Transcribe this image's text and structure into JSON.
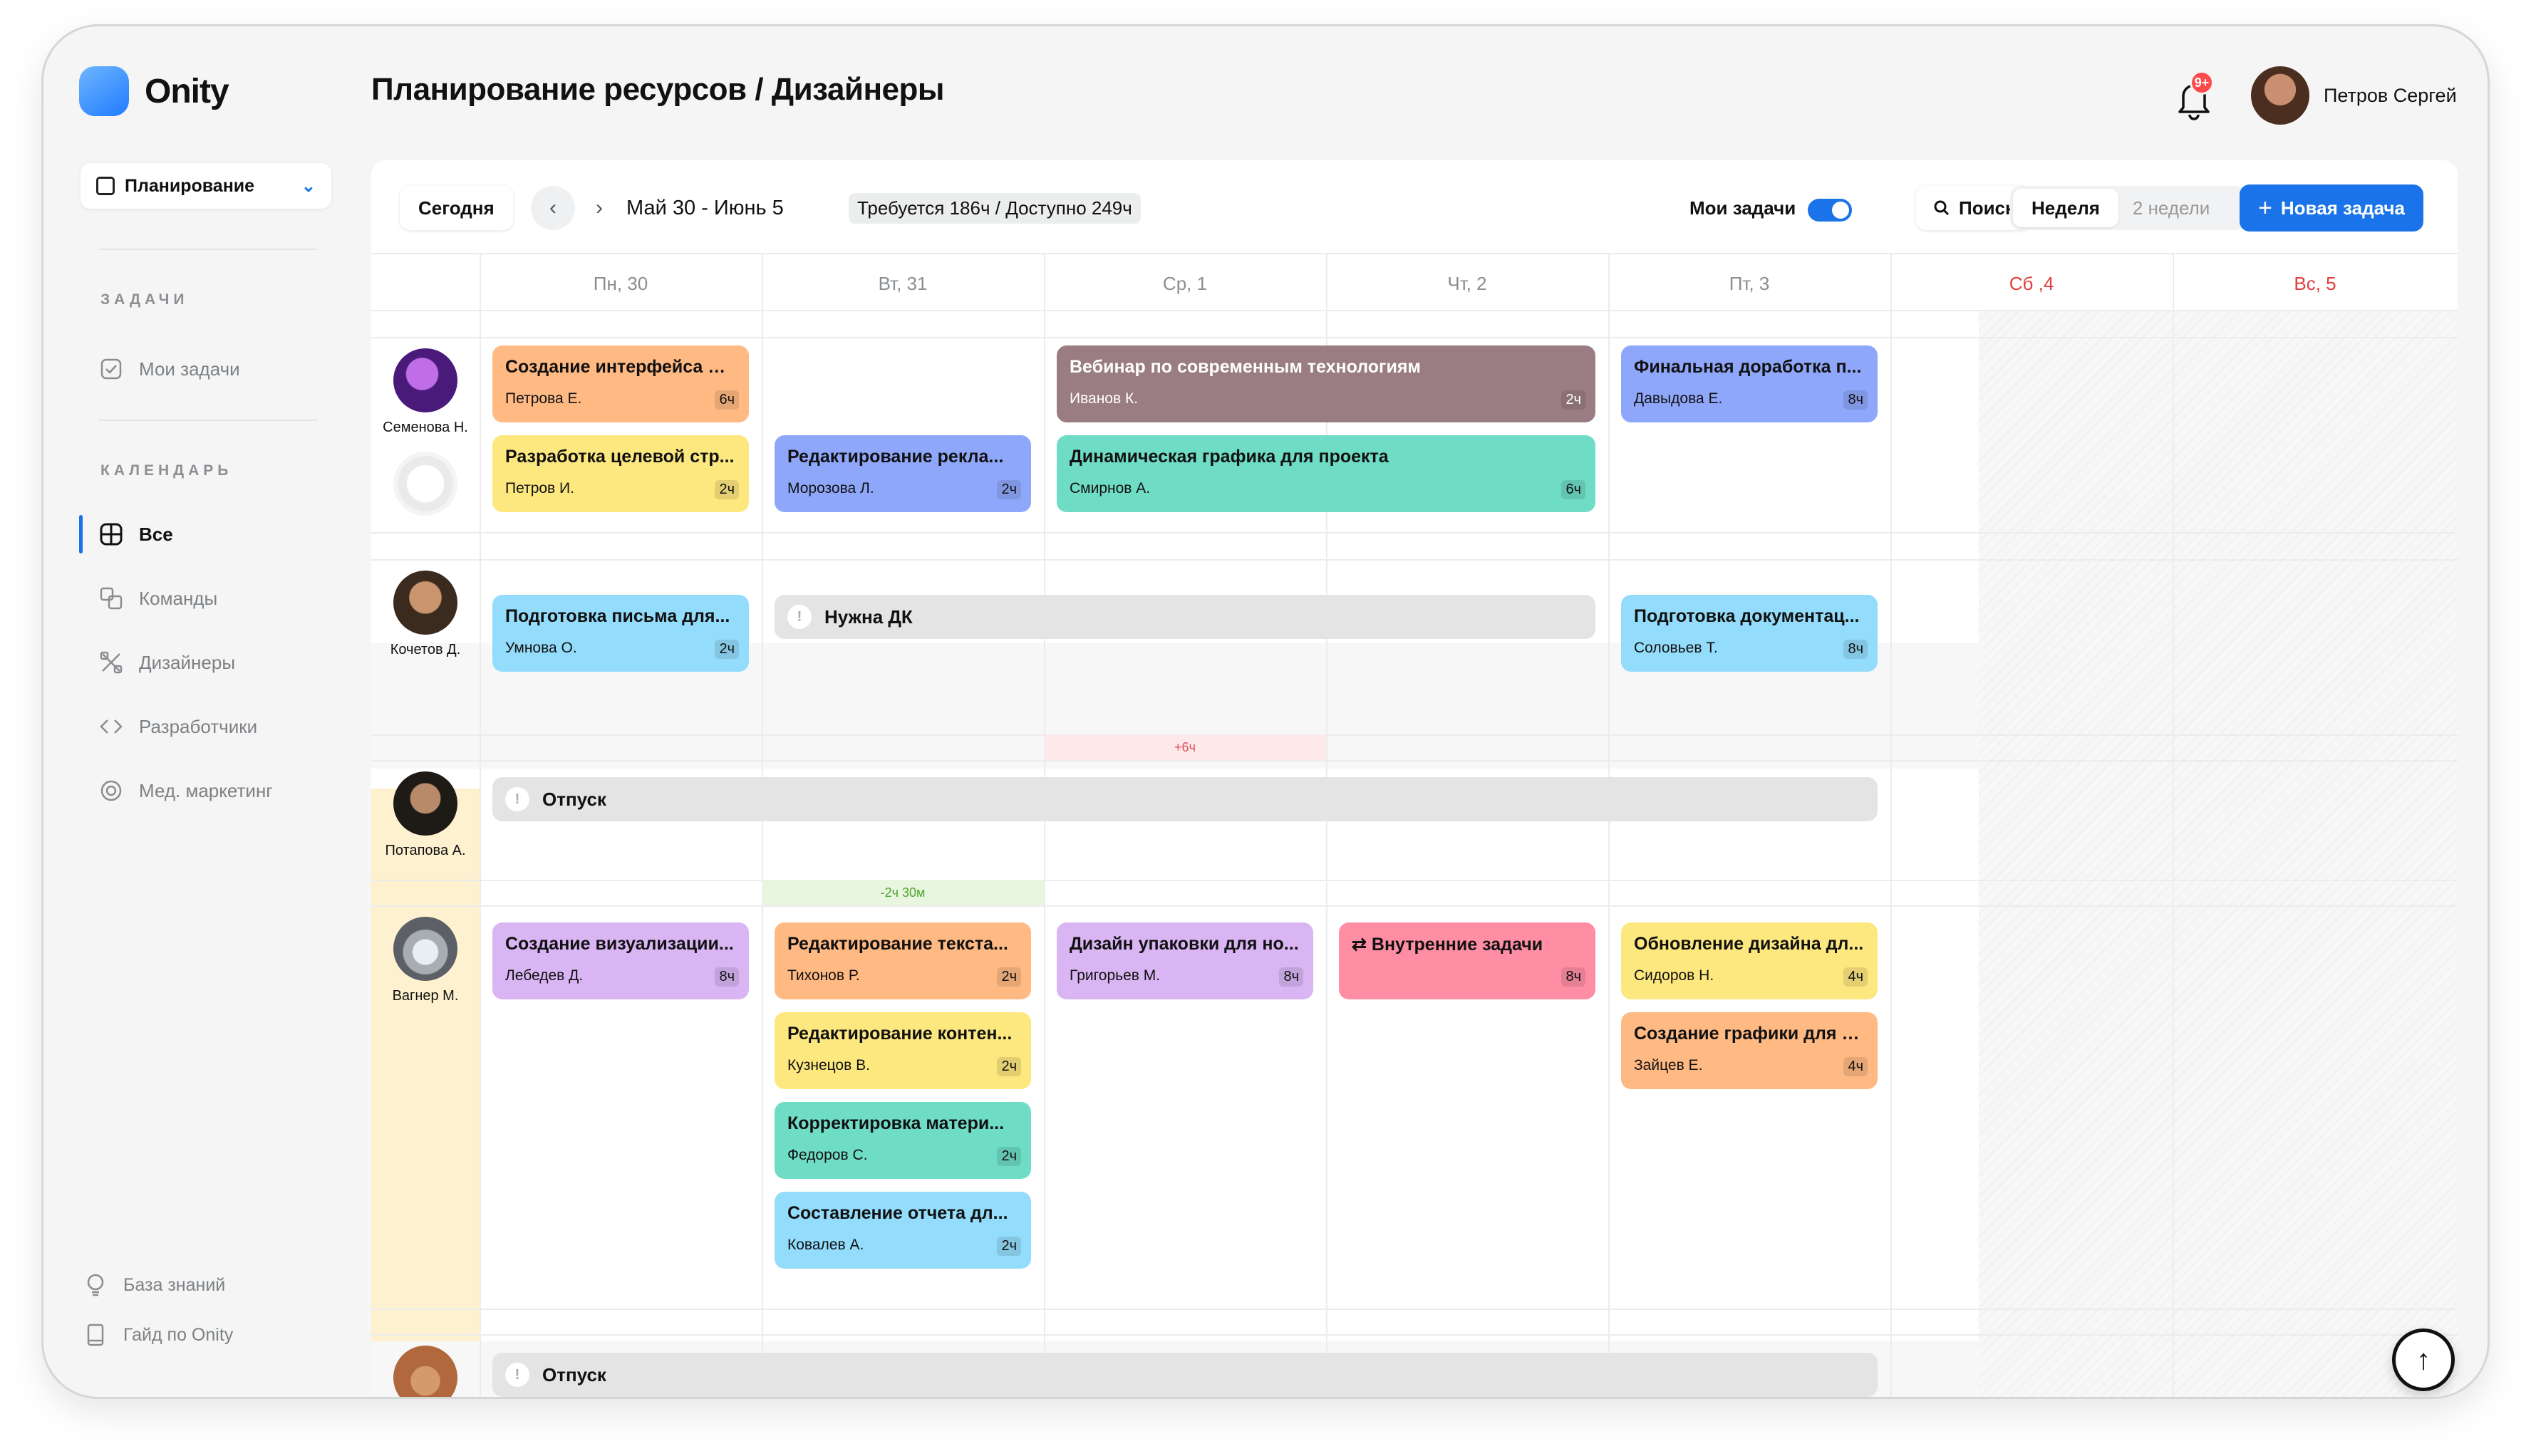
{
  "app": {
    "name": "Onity",
    "page_title": "Планирование ресурсов / Дизайнеры"
  },
  "user": {
    "name": "Петров Сергей",
    "notifications": "9+"
  },
  "sidebar": {
    "workspace": "Планирование",
    "section_tasks": "ЗАДАЧИ",
    "my_tasks": "Мои задачи",
    "section_calendar": "КАЛЕНДАРЬ",
    "items": [
      {
        "label": "Все",
        "icon": "grid-icon"
      },
      {
        "label": "Команды",
        "icon": "teams-icon"
      },
      {
        "label": "Дизайнеры",
        "icon": "design-tools-icon"
      },
      {
        "label": "Разработчики",
        "icon": "code-icon"
      },
      {
        "label": "Мед. маркетинг",
        "icon": "support-icon"
      }
    ],
    "footer": [
      {
        "label": "База знаний",
        "icon": "lightbulb-icon"
      },
      {
        "label": "Гайд по Onity",
        "icon": "book-icon"
      }
    ]
  },
  "toolbar": {
    "today": "Сегодня",
    "range": "Май 30 - Июнь 5",
    "capacity": "Требуется 186ч / Доступно 249ч",
    "my_tasks_label": "Мои задачи",
    "my_tasks_on": true,
    "search": "Поиск",
    "view_week": "Неделя",
    "view_two_weeks": "2 недели",
    "new_task": "Новая задача"
  },
  "days": [
    {
      "label": "Пн, 30",
      "weekend": false
    },
    {
      "label": "Вт, 31",
      "weekend": false
    },
    {
      "label": "Ср, 1",
      "weekend": false
    },
    {
      "label": "Чт, 2",
      "weekend": false
    },
    {
      "label": "Пт, 3",
      "weekend": false
    },
    {
      "label": "Сб ,4",
      "weekend": true
    },
    {
      "label": "Вс, 5",
      "weekend": true
    }
  ],
  "people": [
    "Семенова Н.",
    "Кочетов Д.",
    "Потапова А.",
    "Вагнер М.",
    ""
  ],
  "tasks": [
    {
      "title": "Создание интерфейса для нового приложения",
      "assignee": "Петрова Е.",
      "hours": "6ч",
      "color": "#ffb983"
    },
    {
      "title": "Вебинар по современным технологиям",
      "assignee": "Иванов К.",
      "hours": "2ч",
      "color": "#9a7d83"
    },
    {
      "title": "Финальная доработка п...",
      "assignee": "Давыдова Е.",
      "hours": "8ч",
      "color": "#8fa7fb"
    },
    {
      "title": "Разработка целевой стр...",
      "assignee": "Петров И.",
      "hours": "2ч",
      "color": "#fde77f"
    },
    {
      "title": "Редактирование рекла...",
      "assignee": "Морозова Л.",
      "hours": "2ч",
      "color": "#8fa7fb"
    },
    {
      "title": "Динамическая графика для проекта",
      "assignee": "Смирнов А.",
      "hours": "6ч",
      "color": "#6fdcc6"
    },
    {
      "title": "Подготовка письма для...",
      "assignee": "Умнова О.",
      "hours": "2ч",
      "color": "#93dcfb"
    },
    {
      "title": "Подготовка документац...",
      "assignee": "Соловьев Т.",
      "hours": "8ч",
      "color": "#93dcfb"
    },
    {
      "title": "Создание визуализации...",
      "assignee": "Лебедев Д.",
      "hours": "8ч",
      "color": "#d9b5f3"
    },
    {
      "title": "Редактирование текста...",
      "assignee": "Тихонов Р.",
      "hours": "2ч",
      "color": "#ffb983"
    },
    {
      "title": "Дизайн упаковки для но...",
      "assignee": "Григорьев М.",
      "hours": "8ч",
      "color": "#d9b5f3"
    },
    {
      "title": "Внутренние задачи",
      "assignee": "",
      "hours": "8ч",
      "color": "#ff8ea5"
    },
    {
      "title": "Обновление дизайна дл...",
      "assignee": "Сидоров Н.",
      "hours": "4ч",
      "color": "#fde77f"
    },
    {
      "title": "Редактирование контен...",
      "assignee": "Кузнецов В.",
      "hours": "2ч",
      "color": "#fde77f"
    },
    {
      "title": "Создание графики для с...",
      "assignee": "Зайцев Е.",
      "hours": "4ч",
      "color": "#ffb983"
    },
    {
      "title": "Корректировка матери...",
      "assignee": "Федоров С.",
      "hours": "2ч",
      "color": "#6fdcc6"
    },
    {
      "title": "Составление отчета дл...",
      "assignee": "Ковалев А.",
      "hours": "2ч",
      "color": "#93dcfb"
    }
  ],
  "bars": [
    "Нужна ДК",
    "Отпуск",
    "Отпуск"
  ],
  "overflow": [
    "+6ч",
    "-2ч 30м"
  ]
}
